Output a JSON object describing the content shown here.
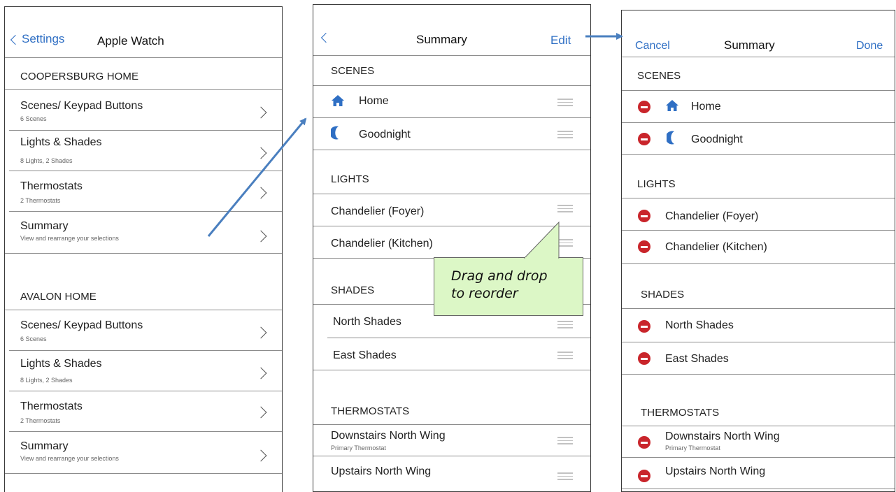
{
  "screen1": {
    "back_label": "Settings",
    "title": "Apple Watch",
    "home1": {
      "name": "COOPERSBURG HOME",
      "rows": [
        {
          "title": "Scenes/ Keypad Buttons",
          "sub": "6 Scenes"
        },
        {
          "title": "Lights & Shades",
          "sub": "8 Lights, 2 Shades"
        },
        {
          "title": "Thermostats",
          "sub": "2 Thermostats"
        },
        {
          "title": "Summary",
          "sub": "View and rearrange your selections"
        }
      ]
    },
    "home2": {
      "name": "AVALON HOME",
      "rows": [
        {
          "title": "Scenes/ Keypad Buttons",
          "sub": "6 Scenes"
        },
        {
          "title": "Lights & Shades",
          "sub": "8 Lights, 2 Shades"
        },
        {
          "title": "Thermostats",
          "sub": "2 Thermostats"
        },
        {
          "title": "Summary",
          "sub": "View and rearrange your selections"
        }
      ]
    }
  },
  "screen2": {
    "title": "Summary",
    "edit_label": "Edit",
    "scenes_header": "SCENES",
    "scenes": [
      "Home",
      "Goodnight"
    ],
    "lights_header": "LIGHTS",
    "lights": [
      "Chandelier (Foyer)",
      "Chandelier (Kitchen)"
    ],
    "shades_header": "SHADES",
    "shades": [
      "North Shades",
      "East Shades"
    ],
    "thermostats_header": "THERMOSTATS",
    "thermostats": [
      {
        "title": "Downstairs North Wing",
        "sub": "Primary Thermostat"
      },
      {
        "title": "Upstairs North Wing",
        "sub": ""
      }
    ]
  },
  "screen3": {
    "cancel_label": "Cancel",
    "title": "Summary",
    "done_label": "Done",
    "scenes_header": "SCENES",
    "scenes": [
      "Home",
      "Goodnight"
    ],
    "lights_header": "LIGHTS",
    "lights": [
      "Chandelier (Foyer)",
      "Chandelier (Kitchen)"
    ],
    "shades_header": "SHADES",
    "shades": [
      "North Shades",
      "East Shades"
    ],
    "thermostats_header": "THERMOSTATS",
    "thermostats": [
      {
        "title": "Downstairs North Wing",
        "sub": "Primary Thermostat"
      },
      {
        "title": "Upstairs North Wing",
        "sub": ""
      }
    ]
  },
  "callout": {
    "line1": "Drag and drop",
    "line2": "to reorder"
  },
  "colors": {
    "link": "#2f6fc4",
    "delete": "#c9252b",
    "callout_bg": "#dcf7c6",
    "arrow": "#4a7fbf"
  },
  "icons": {
    "home_scene": "house-icon",
    "goodnight_scene": "moon-icon",
    "reorder": "drag-handle-icon",
    "remove": "delete-icon"
  }
}
